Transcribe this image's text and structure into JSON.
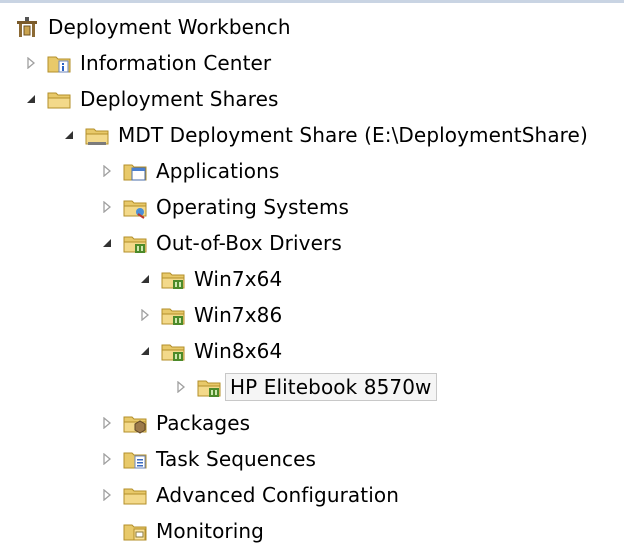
{
  "tree": {
    "root": {
      "label": "Deployment Workbench",
      "icon": "workbench-icon"
    },
    "information_center": {
      "label": "Information Center",
      "icon": "info-folder-icon",
      "expander": "collapsed"
    },
    "deployment_shares": {
      "label": "Deployment Shares",
      "icon": "folder-icon",
      "expander": "expanded"
    },
    "mdt_share": {
      "label": "MDT Deployment Share (E:\\DeploymentShare)",
      "icon": "share-folder-icon",
      "expander": "expanded"
    },
    "applications": {
      "label": "Applications",
      "icon": "applications-folder-icon",
      "expander": "collapsed"
    },
    "operating_systems": {
      "label": "Operating Systems",
      "icon": "os-folder-icon",
      "expander": "collapsed"
    },
    "out_of_box_drivers": {
      "label": "Out-of-Box Drivers",
      "icon": "drivers-folder-icon",
      "expander": "expanded"
    },
    "win7x64": {
      "label": "Win7x64",
      "icon": "drivers-folder-icon",
      "expander": "expanded"
    },
    "win7x86": {
      "label": "Win7x86",
      "icon": "drivers-folder-icon",
      "expander": "collapsed"
    },
    "win8x64": {
      "label": "Win8x64",
      "icon": "drivers-folder-icon",
      "expander": "expanded"
    },
    "hp_elitebook": {
      "label": "HP Elitebook 8570w",
      "icon": "drivers-folder-icon",
      "expander": "collapsed",
      "selected": true
    },
    "packages": {
      "label": "Packages",
      "icon": "packages-folder-icon",
      "expander": "collapsed"
    },
    "task_sequences": {
      "label": "Task Sequences",
      "icon": "task-sequence-folder-icon",
      "expander": "collapsed"
    },
    "advanced_configuration": {
      "label": "Advanced Configuration",
      "icon": "folder-icon",
      "expander": "collapsed"
    },
    "monitoring": {
      "label": "Monitoring",
      "icon": "monitoring-folder-icon"
    }
  },
  "colors": {
    "selection_border": "#c8c8c8",
    "folder": "#e8c96a",
    "driver_green": "#4c8a2a"
  }
}
